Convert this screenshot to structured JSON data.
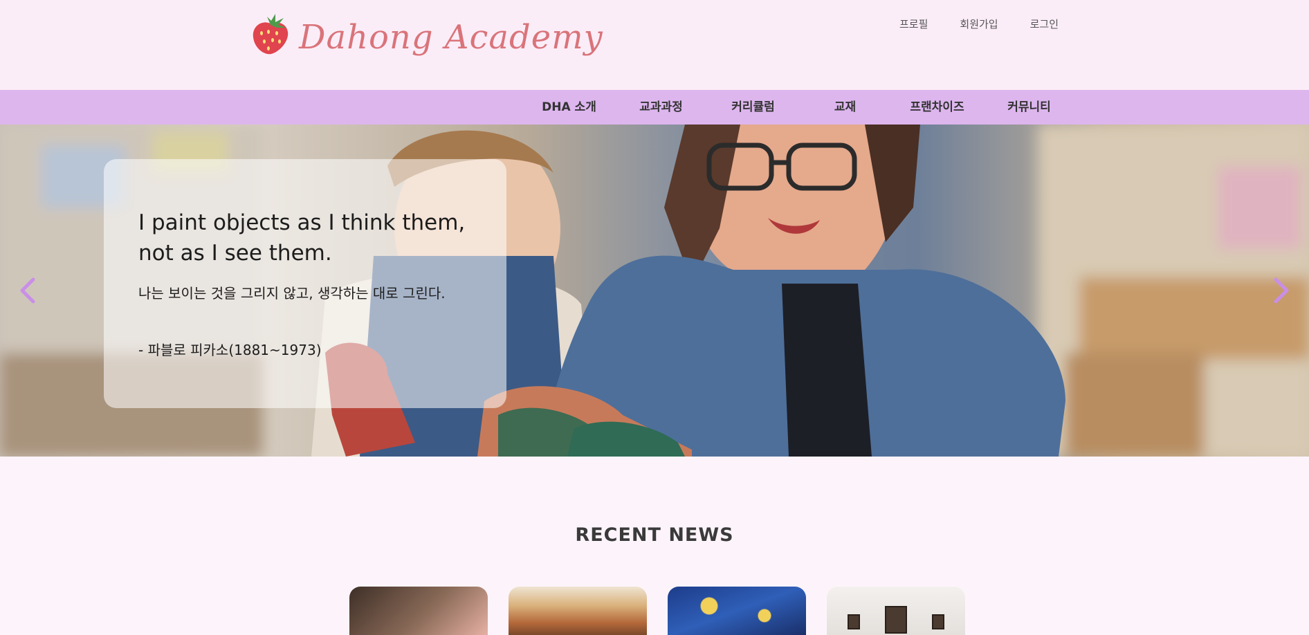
{
  "brand": {
    "name": "Dahong Academy",
    "logo_icon": "strawberry-icon"
  },
  "util_nav": [
    "프로필",
    "회원가입",
    "로그인"
  ],
  "main_nav": [
    "DHA 소개",
    "교과과정",
    "커리큘럼",
    "교재",
    "프랜차이즈",
    "커뮤니티"
  ],
  "hero": {
    "quote_en": "I paint objects as I think them, not as I see them.",
    "quote_ko": "나는 보이는 것을 그리지 않고, 생각하는 대로 그린다.",
    "author": "- 파블로 피카소(1881~1973)",
    "prev_icon": "chevron-left-icon",
    "next_icon": "chevron-right-icon"
  },
  "news": {
    "title": "RECENT NEWS"
  },
  "colors": {
    "header_bg": "#fbedf8",
    "nav_bg": "#ddb6ee",
    "accent": "#c98fe6",
    "logo_text": "#d9747a"
  }
}
